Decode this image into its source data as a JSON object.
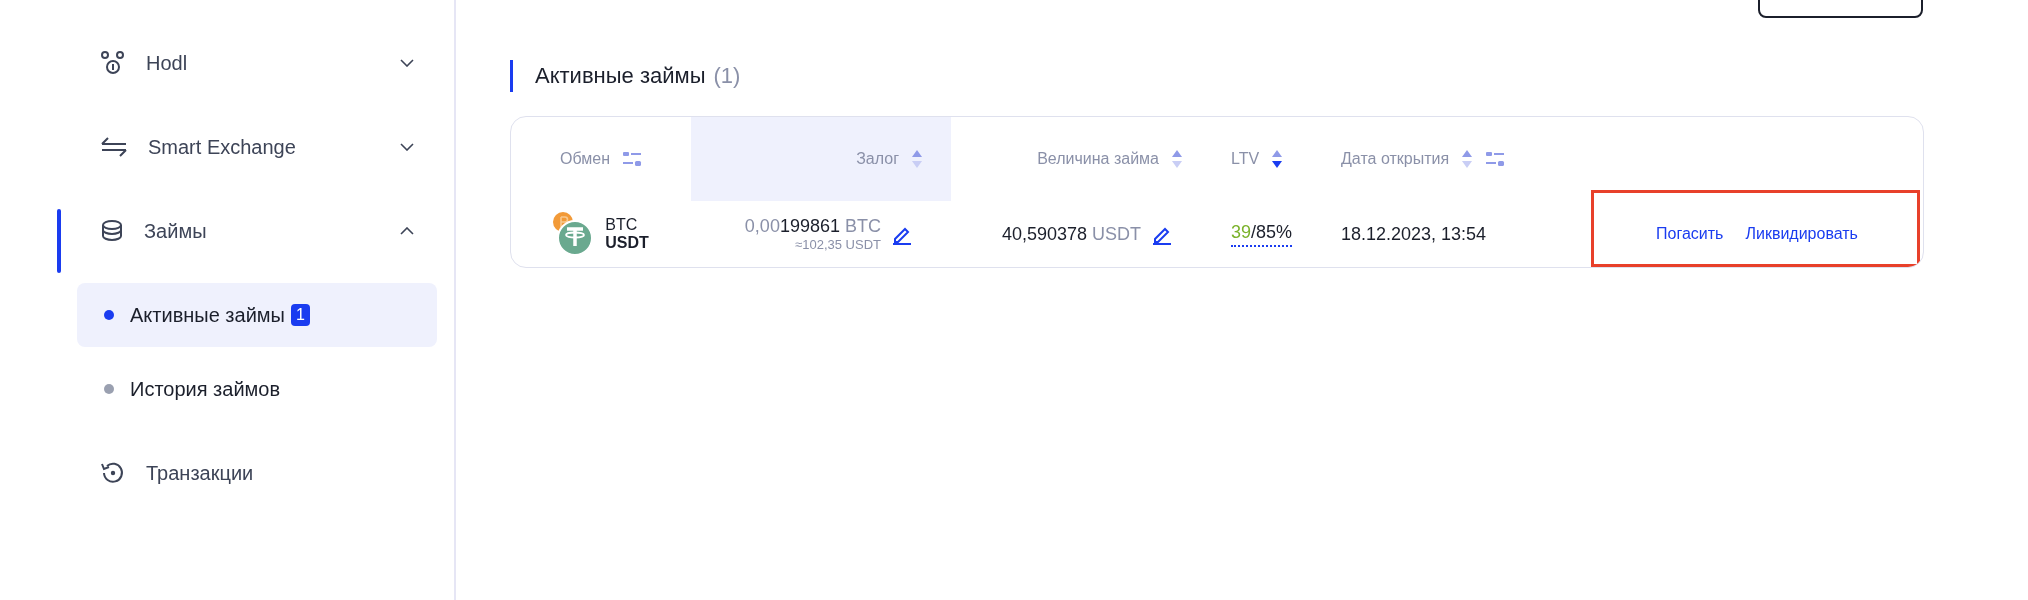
{
  "sidebar": {
    "items": [
      {
        "label": "Hodl",
        "expanded": false,
        "active": false
      },
      {
        "label": "Smart Exchange",
        "expanded": false,
        "active": false
      },
      {
        "label": "Займы",
        "expanded": true,
        "active": true,
        "children": [
          {
            "label": "Активные займы",
            "badge": "1",
            "selected": true
          },
          {
            "label": "История займов",
            "selected": false
          }
        ]
      },
      {
        "label": "Транзакции",
        "active": false
      }
    ]
  },
  "section": {
    "title": "Активные займы",
    "count": "(1)"
  },
  "table": {
    "columns": [
      {
        "label": "Обмен",
        "sortable": false,
        "filter": true,
        "highlighted": false
      },
      {
        "label": "Залог",
        "sortable": true,
        "sorted_desc": false,
        "filter": false,
        "highlighted": true
      },
      {
        "label": "Величина займа",
        "sortable": true,
        "sorted_desc": false,
        "filter": false,
        "highlighted": false
      },
      {
        "label": "LTV",
        "sortable": true,
        "sorted_desc": true,
        "filter": false,
        "highlighted": false
      },
      {
        "label": "Дата открытия",
        "sortable": true,
        "sorted_desc": false,
        "filter": true,
        "highlighted": false
      }
    ],
    "rows": [
      {
        "base": "BTC",
        "quote": "USDT",
        "collateral_dim": "0,00",
        "collateral_main": "199861",
        "collateral_unit": "BTC",
        "collateral_approx": "≈102,35 USDT",
        "loan": "40,590378",
        "loan_unit": "USDT",
        "ltv": "39",
        "ltv_max": "/85%",
        "date": "18.12.2023, 13:54",
        "actions": [
          "Погасить",
          "Ликвидировать"
        ]
      }
    ]
  }
}
